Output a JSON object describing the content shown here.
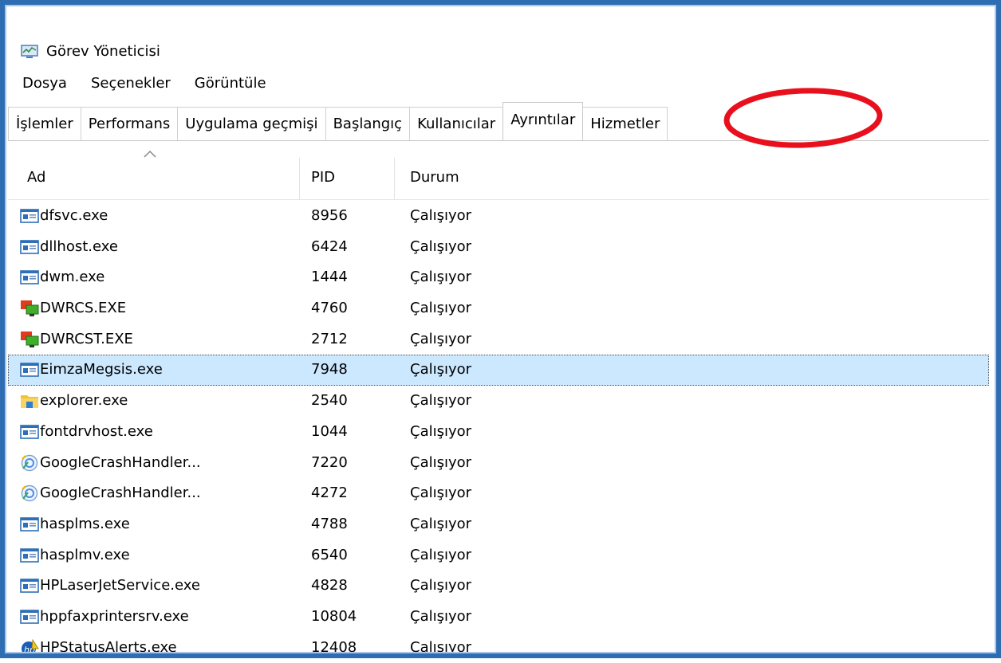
{
  "window": {
    "title": "Görev Yöneticisi",
    "app_icon": "task-manager-icon"
  },
  "menu": [
    "Dosya",
    "Seçenekler",
    "Görüntüle"
  ],
  "tabs": [
    {
      "label": "İşlemler"
    },
    {
      "label": "Performans"
    },
    {
      "label": "Uygulama geçmişi"
    },
    {
      "label": "Başlangıç"
    },
    {
      "label": "Kullanıcılar"
    },
    {
      "label": "Ayrıntılar",
      "active": true
    },
    {
      "label": "Hizmetler"
    }
  ],
  "annotation": {
    "shape": "ellipse",
    "color": "#e8101c",
    "target": "Ayrıntılar"
  },
  "columns": {
    "name": "Ad",
    "pid": "PID",
    "status": "Durum"
  },
  "rows": [
    {
      "name": "dfsvc.exe",
      "pid": "8956",
      "status": "Çalışıyor",
      "icon": "app-window-icon"
    },
    {
      "name": "dllhost.exe",
      "pid": "6424",
      "status": "Çalışıyor",
      "icon": "app-window-icon"
    },
    {
      "name": "dwm.exe",
      "pid": "1444",
      "status": "Çalışıyor",
      "icon": "app-window-icon"
    },
    {
      "name": "DWRCS.EXE",
      "pid": "4760",
      "status": "Çalışıyor",
      "icon": "remote-control-icon"
    },
    {
      "name": "DWRCST.EXE",
      "pid": "2712",
      "status": "Çalışıyor",
      "icon": "remote-control-icon"
    },
    {
      "name": "EimzaMegsis.exe",
      "pid": "7948",
      "status": "Çalışıyor",
      "icon": "app-window-icon",
      "selected": true
    },
    {
      "name": "explorer.exe",
      "pid": "2540",
      "status": "Çalışıyor",
      "icon": "folder-icon"
    },
    {
      "name": "fontdrvhost.exe",
      "pid": "1044",
      "status": "Çalışıyor",
      "icon": "app-window-icon"
    },
    {
      "name": "GoogleCrashHandler...",
      "pid": "7220",
      "status": "Çalışıyor",
      "icon": "google-update-icon"
    },
    {
      "name": "GoogleCrashHandler...",
      "pid": "4272",
      "status": "Çalışıyor",
      "icon": "google-update-icon"
    },
    {
      "name": "hasplms.exe",
      "pid": "4788",
      "status": "Çalışıyor",
      "icon": "app-window-icon"
    },
    {
      "name": "hasplmv.exe",
      "pid": "6540",
      "status": "Çalışıyor",
      "icon": "app-window-icon"
    },
    {
      "name": "HPLaserJetService.exe",
      "pid": "4828",
      "status": "Çalışıyor",
      "icon": "app-window-icon"
    },
    {
      "name": "hppfaxprintersrv.exe",
      "pid": "10804",
      "status": "Çalışıyor",
      "icon": "app-window-icon"
    },
    {
      "name": "HPStatusAlerts.exe",
      "pid": "12408",
      "status": "Çalışıyor",
      "icon": "hp-alert-icon"
    }
  ]
}
